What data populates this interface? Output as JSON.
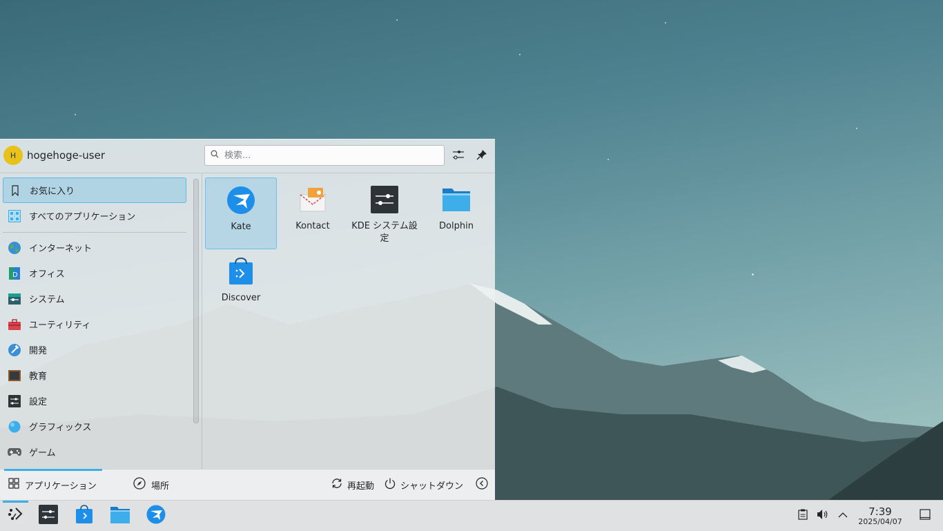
{
  "launcher": {
    "user": {
      "initial": "H",
      "name": "hogehoge-user"
    },
    "search": {
      "placeholder": "検索..."
    },
    "categories": [
      {
        "label": "お気に入り"
      },
      {
        "label": "すべてのアプリケーション"
      },
      {
        "label": "インターネット"
      },
      {
        "label": "オフィス"
      },
      {
        "label": "システム"
      },
      {
        "label": "ユーティリティ"
      },
      {
        "label": "開発"
      },
      {
        "label": "教育"
      },
      {
        "label": "設定"
      },
      {
        "label": "グラフィックス"
      },
      {
        "label": "ゲーム"
      }
    ],
    "apps": [
      {
        "label": "Kate"
      },
      {
        "label": "Kontact"
      },
      {
        "label": "KDE システム設定"
      },
      {
        "label": "Dolphin"
      },
      {
        "label": "Discover"
      }
    ],
    "footer": {
      "tab_apps": "アプリケーション",
      "tab_places": "場所",
      "restart": "再起動",
      "shutdown": "シャットダウン"
    }
  },
  "taskbar": {
    "clock": {
      "time": "7:39",
      "date": "2025/04/07"
    }
  },
  "colors": {
    "accent": "#3daee9",
    "avatar": "#e8c21a"
  }
}
